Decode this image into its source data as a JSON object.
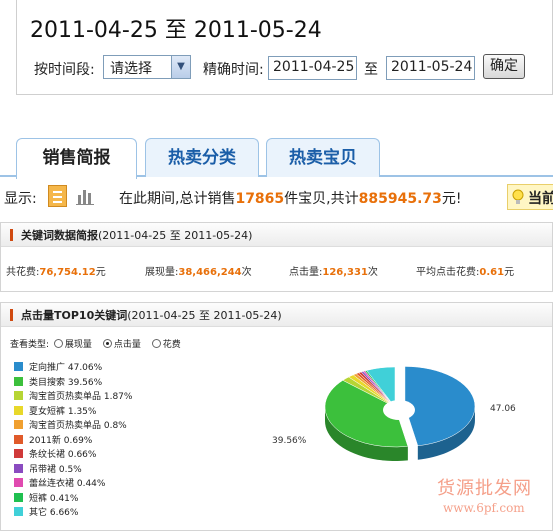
{
  "header": {
    "range_title": "2011-04-25 至 2011-05-24",
    "period_label": "按时间段:",
    "period_select": "请选择",
    "exact_label": "精确时间:",
    "date_from": "2011-04-25",
    "to_label": "至",
    "date_to": "2011-05-24",
    "ok_button": "确定"
  },
  "tabs": [
    {
      "label": "销售简报",
      "active": true
    },
    {
      "label": "热卖分类",
      "active": false
    },
    {
      "label": "热卖宝贝",
      "active": false
    }
  ],
  "summary": {
    "display_label": "显示:",
    "prefix": "在此期间,总计销售",
    "items_sold": "17865",
    "middle": "件宝贝,共计",
    "amount": "885945.73",
    "suffix": "元!",
    "tip": "当前"
  },
  "keyword_report": {
    "title": "关键词数据简报",
    "range": "(2011-04-25 至 2011-05-24)",
    "stats": [
      {
        "label": "共花费:",
        "value": "76,754.12",
        "unit": "元"
      },
      {
        "label": "展现量:",
        "value": "38,466,244",
        "unit": "次"
      },
      {
        "label": "点击量:",
        "value": "126,331",
        "unit": "次"
      },
      {
        "label": "平均点击花费:",
        "value": "0.61",
        "unit": "元"
      }
    ]
  },
  "top10": {
    "title": "点击量TOP10关键词",
    "range": "(2011-04-25 至 2011-05-24)",
    "view_label": "查看类型:",
    "options": [
      {
        "label": "展现量",
        "selected": false
      },
      {
        "label": "点击量",
        "selected": true
      },
      {
        "label": "花费",
        "selected": false
      }
    ]
  },
  "chart_data": {
    "type": "pie",
    "categories": [
      "定向推广",
      "类目搜索",
      "淘宝首页热卖单品",
      "夏女短裤",
      "淘宝首页热卖单品",
      "2011新",
      "条纹长裙",
      "吊带裙",
      "蕾丝连衣裙",
      "短裤",
      "其它"
    ],
    "values": [
      47.06,
      39.56,
      1.87,
      1.35,
      0.8,
      0.69,
      0.66,
      0.5,
      0.44,
      0.41,
      6.66
    ],
    "value_labels": [
      "47.06%",
      "39.56%",
      "1.87%",
      "1.35%",
      "0.8%",
      "0.69%",
      "0.66%",
      "0.5%",
      "0.44%",
      "0.41%",
      "6.66%"
    ],
    "colors": [
      "#2a8ccc",
      "#3cc03c",
      "#b6d534",
      "#e8d82a",
      "#f0a030",
      "#e05a2a",
      "#d03a3a",
      "#8a4bc0",
      "#e04ab0",
      "#20c050",
      "#40d0d8"
    ],
    "slice_labels": [
      "47.06",
      "39.56%"
    ],
    "legend": "left"
  },
  "watermark": {
    "line1": "货源批发网",
    "line2": "www.6pf.com"
  }
}
